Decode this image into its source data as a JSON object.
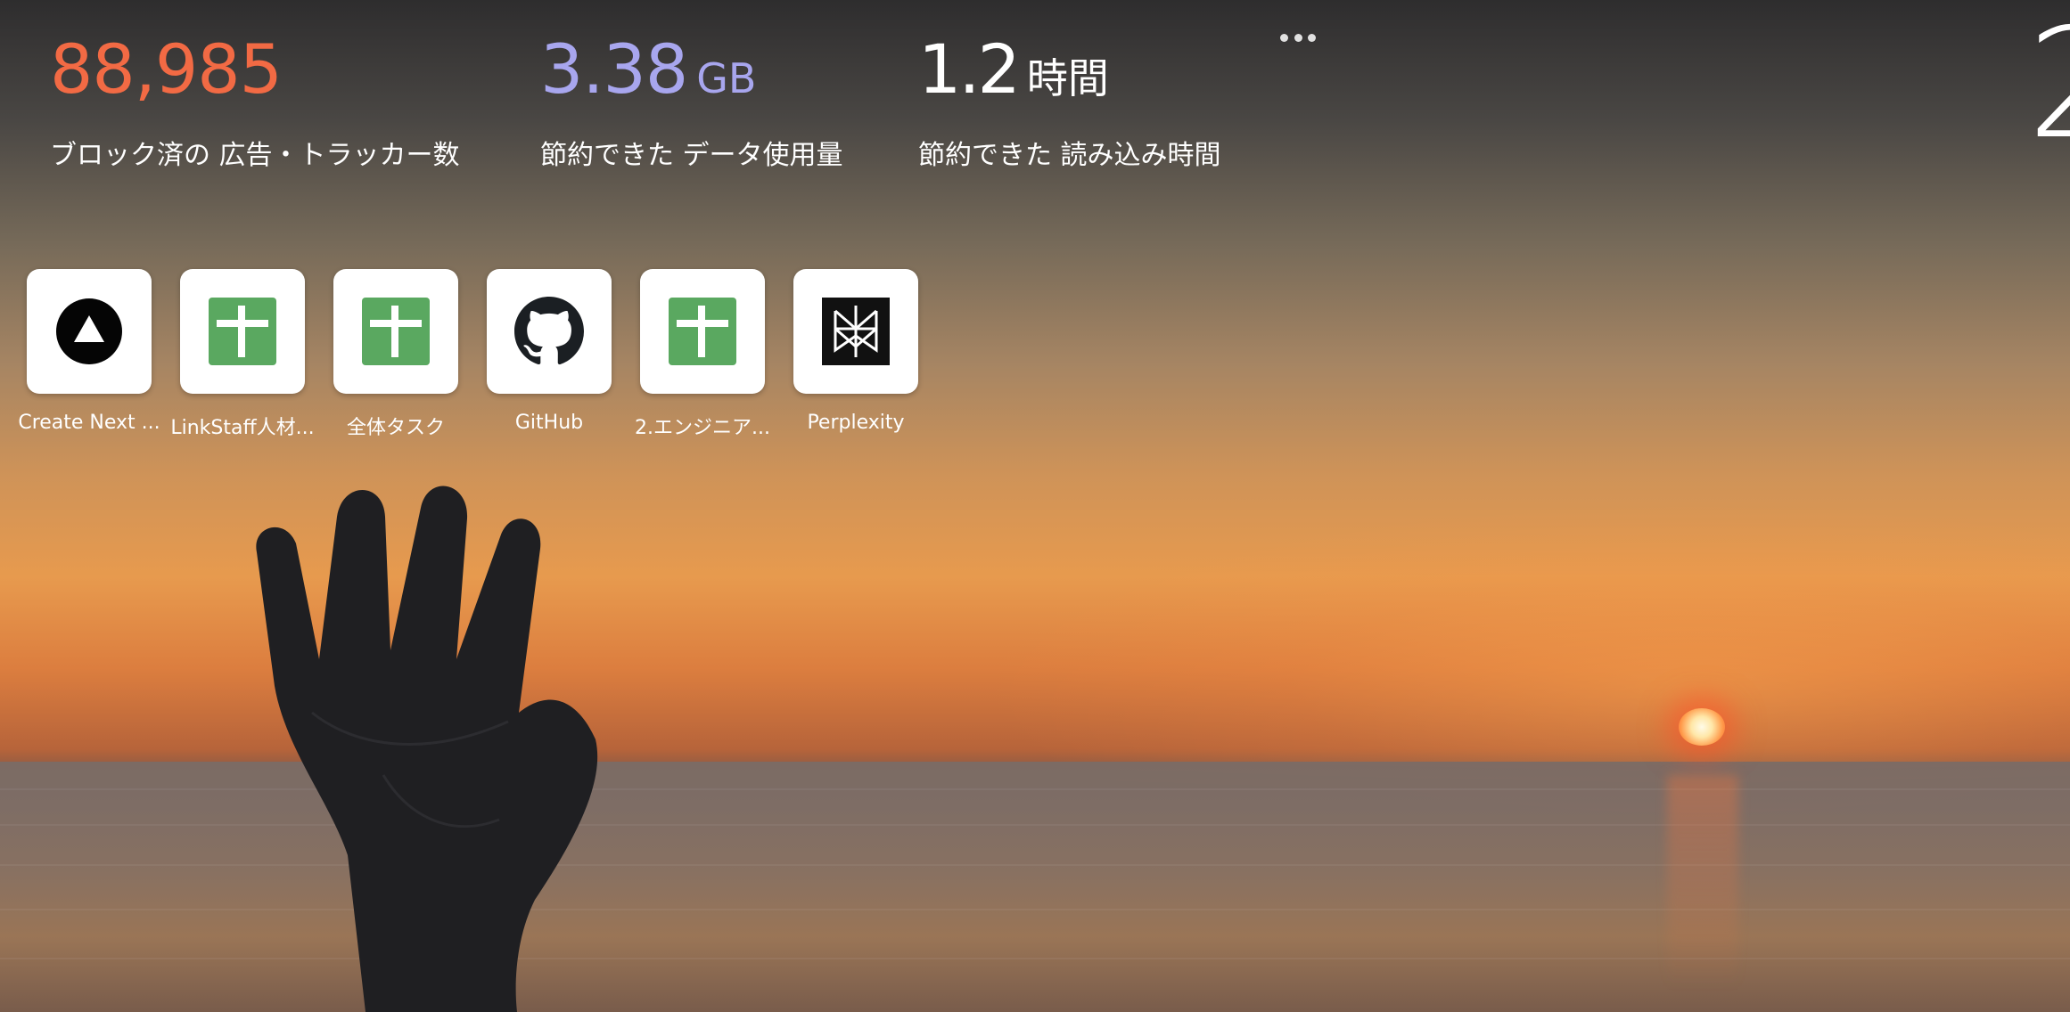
{
  "stats": {
    "ads_blocked": {
      "value": "88,985",
      "label": "ブロック済の 広告・トラッカー数",
      "color": "#f26a44"
    },
    "data_saved": {
      "value": "3.38",
      "unit": "GB",
      "label": "節約できた データ使用量",
      "color": "#a8a6ee"
    },
    "time_saved": {
      "value": "1.2",
      "unit": "時間",
      "label": "節約できた 読み込み時間"
    }
  },
  "more_menu": {
    "icon": "more-dots-icon"
  },
  "clock": {
    "partial_text": "2"
  },
  "shortcuts": [
    {
      "label": "Create Next ...",
      "icon": "triangle-logo-icon"
    },
    {
      "label": "LinkStaff人材...",
      "icon": "spreadsheet-icon"
    },
    {
      "label": "全体タスク",
      "icon": "spreadsheet-icon"
    },
    {
      "label": "GitHub",
      "icon": "github-icon"
    },
    {
      "label": "2.エンジニア...",
      "icon": "spreadsheet-icon"
    },
    {
      "label": "Perplexity",
      "icon": "perplexity-icon"
    }
  ]
}
